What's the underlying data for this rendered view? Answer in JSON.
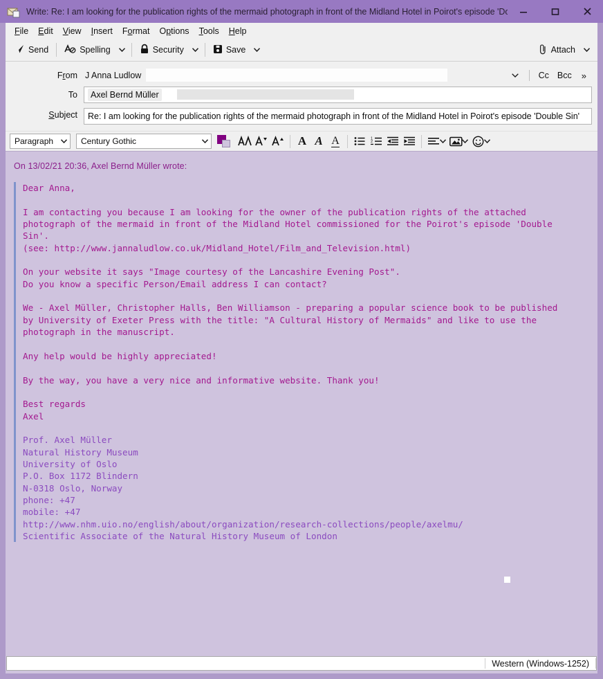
{
  "window": {
    "title": "Write: Re: I am looking for the publication rights of the mermaid photograph in front of the Midland Hotel in Poirot's episode 'Do...",
    "icon": "compose-mail-icon",
    "minimize": "–",
    "maximize": "❐",
    "close": "✕",
    "titlebar_color": "#9879c2",
    "frame_color": "#ae9ac9"
  },
  "menubar": {
    "items": [
      {
        "label": "File",
        "accel": "F"
      },
      {
        "label": "Edit",
        "accel": "E"
      },
      {
        "label": "View",
        "accel": "V"
      },
      {
        "label": "Insert",
        "accel": "I"
      },
      {
        "label": "Format",
        "accel": "o"
      },
      {
        "label": "Options",
        "accel": "p"
      },
      {
        "label": "Tools",
        "accel": "T"
      },
      {
        "label": "Help",
        "accel": "H"
      }
    ]
  },
  "toolbar": {
    "send_label": "Send",
    "spelling_label": "Spelling",
    "security_label": "Security",
    "save_label": "Save",
    "attach_label": "Attach",
    "caret": "⌄"
  },
  "headers": {
    "from_label": "From",
    "from_accel": "r",
    "from_value": "J Anna Ludlow",
    "from_redacted": true,
    "to_label": "To",
    "to_value": "Axel Bernd Müller",
    "to_redacted": true,
    "subject_label": "Subject",
    "subject_accel": "S",
    "subject_value": "Re: I am looking for the publication rights of the mermaid photograph in front of the Midland Hotel in Poirot's episode 'Double Sin'",
    "cc_label": "Cc",
    "bcc_label": "Bcc",
    "more_label": "»"
  },
  "formatbar": {
    "paragraph_style": "Paragraph",
    "font_family": "Century Gothic",
    "color_swatch": "#800080",
    "buttons": [
      {
        "name": "font-color-icon",
        "glyph": "AA"
      },
      {
        "name": "decrease-font-size-icon",
        "glyph": "A"
      },
      {
        "name": "increase-font-size-icon",
        "glyph": "A"
      },
      {
        "name": "bold-icon",
        "glyph": "A"
      },
      {
        "name": "italic-icon",
        "glyph": "A"
      },
      {
        "name": "underline-icon",
        "glyph": "A"
      },
      {
        "name": "bullet-list-icon",
        "glyph": "☰"
      },
      {
        "name": "numbered-list-icon",
        "glyph": "☰"
      },
      {
        "name": "outdent-icon",
        "glyph": "←"
      },
      {
        "name": "indent-icon",
        "glyph": "→"
      },
      {
        "name": "align-icon",
        "glyph": "≡"
      },
      {
        "name": "insert-image-icon",
        "glyph": "⛰"
      },
      {
        "name": "insert-emoticon-icon",
        "glyph": "☺"
      }
    ]
  },
  "compose": {
    "reply_intro": "On 13/02/21 20:36, Axel Bernd Müller wrote:",
    "quote_color": "#a3198f",
    "quote_bar_color": "#7f93cc",
    "signature_color": "#8b4bbf",
    "background": "#cfc3de",
    "quoted_body": "Dear Anna,\n\nI am contacting you because I am looking for the owner of the publication rights of the attached\nphotograph of the mermaid in front of the Midland Hotel commissioned for the Poirot's episode 'Double\nSin'.\n(see: http://www.jannaludlow.co.uk/Midland_Hotel/Film_and_Television.html)\n\nOn your website it says \"Image courtesy of the Lancashire Evening Post\".\nDo you know a specific Person/Email address I can contact?\n\nWe - Axel Müller, Christopher Halls, Ben Williamson - preparing a popular science book to be published\nby University of Exeter Press with the title: \"A Cultural History of Mermaids\" and like to use the\nphotograph in the manuscript.\n\nAny help would be highly appreciated!\n\nBy the way, you have a very nice and informative website. Thank you!\n\nBest regards\nAxel\n",
    "quoted_signature": "\nProf. Axel Müller\nNatural History Museum\nUniversity of Oslo\nP.O. Box 1172 Blindern\nN-0318 Oslo, Norway\nphone: +47 \nmobile: +47 \nhttp://www.nhm.uio.no/english/about/organization/research-collections/people/axelmu/\nScientific Associate of the Natural History Museum of London"
  },
  "statusbar": {
    "charset": "Western (Windows-1252)"
  }
}
